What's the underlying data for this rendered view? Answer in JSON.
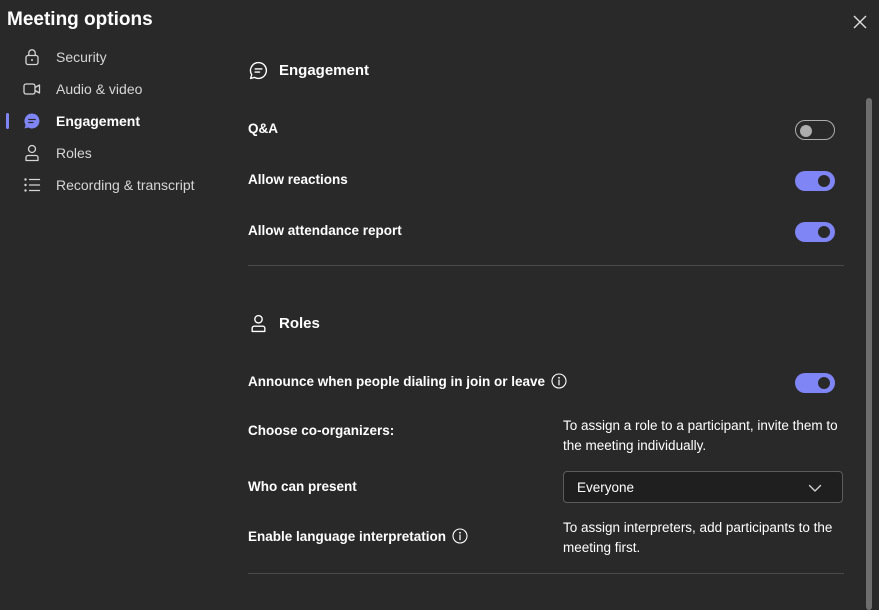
{
  "window": {
    "title": "Meeting options"
  },
  "sidebar": {
    "items": [
      {
        "label": "Security",
        "icon": "lock-icon",
        "active": false
      },
      {
        "label": "Audio & video",
        "icon": "video-camera-icon",
        "active": false
      },
      {
        "label": "Engagement",
        "icon": "chat-bubble-icon",
        "active": true
      },
      {
        "label": "Roles",
        "icon": "person-icon",
        "active": false
      },
      {
        "label": "Recording & transcript",
        "icon": "list-icon",
        "active": false
      }
    ]
  },
  "engagement": {
    "heading": "Engagement",
    "rows": [
      {
        "label": "Q&A",
        "enabled": false
      },
      {
        "label": "Allow reactions",
        "enabled": true
      },
      {
        "label": "Allow attendance report",
        "enabled": true
      }
    ]
  },
  "roles": {
    "heading": "Roles",
    "announce_label": "Announce when people dialing in join or leave",
    "announce_enabled": true,
    "coorganizers_label": "Choose co-organizers:",
    "coorganizers_note": "To assign a role to a participant, invite them to the meeting individually.",
    "who_can_present_label": "Who can present",
    "who_can_present_value": "Everyone",
    "interpretation_label": "Enable language interpretation",
    "interpretation_note": "To assign interpreters, add participants to the meeting first."
  },
  "colors": {
    "accent": "#7f85f5",
    "background": "#292929",
    "divider": "#4a4a4a"
  }
}
